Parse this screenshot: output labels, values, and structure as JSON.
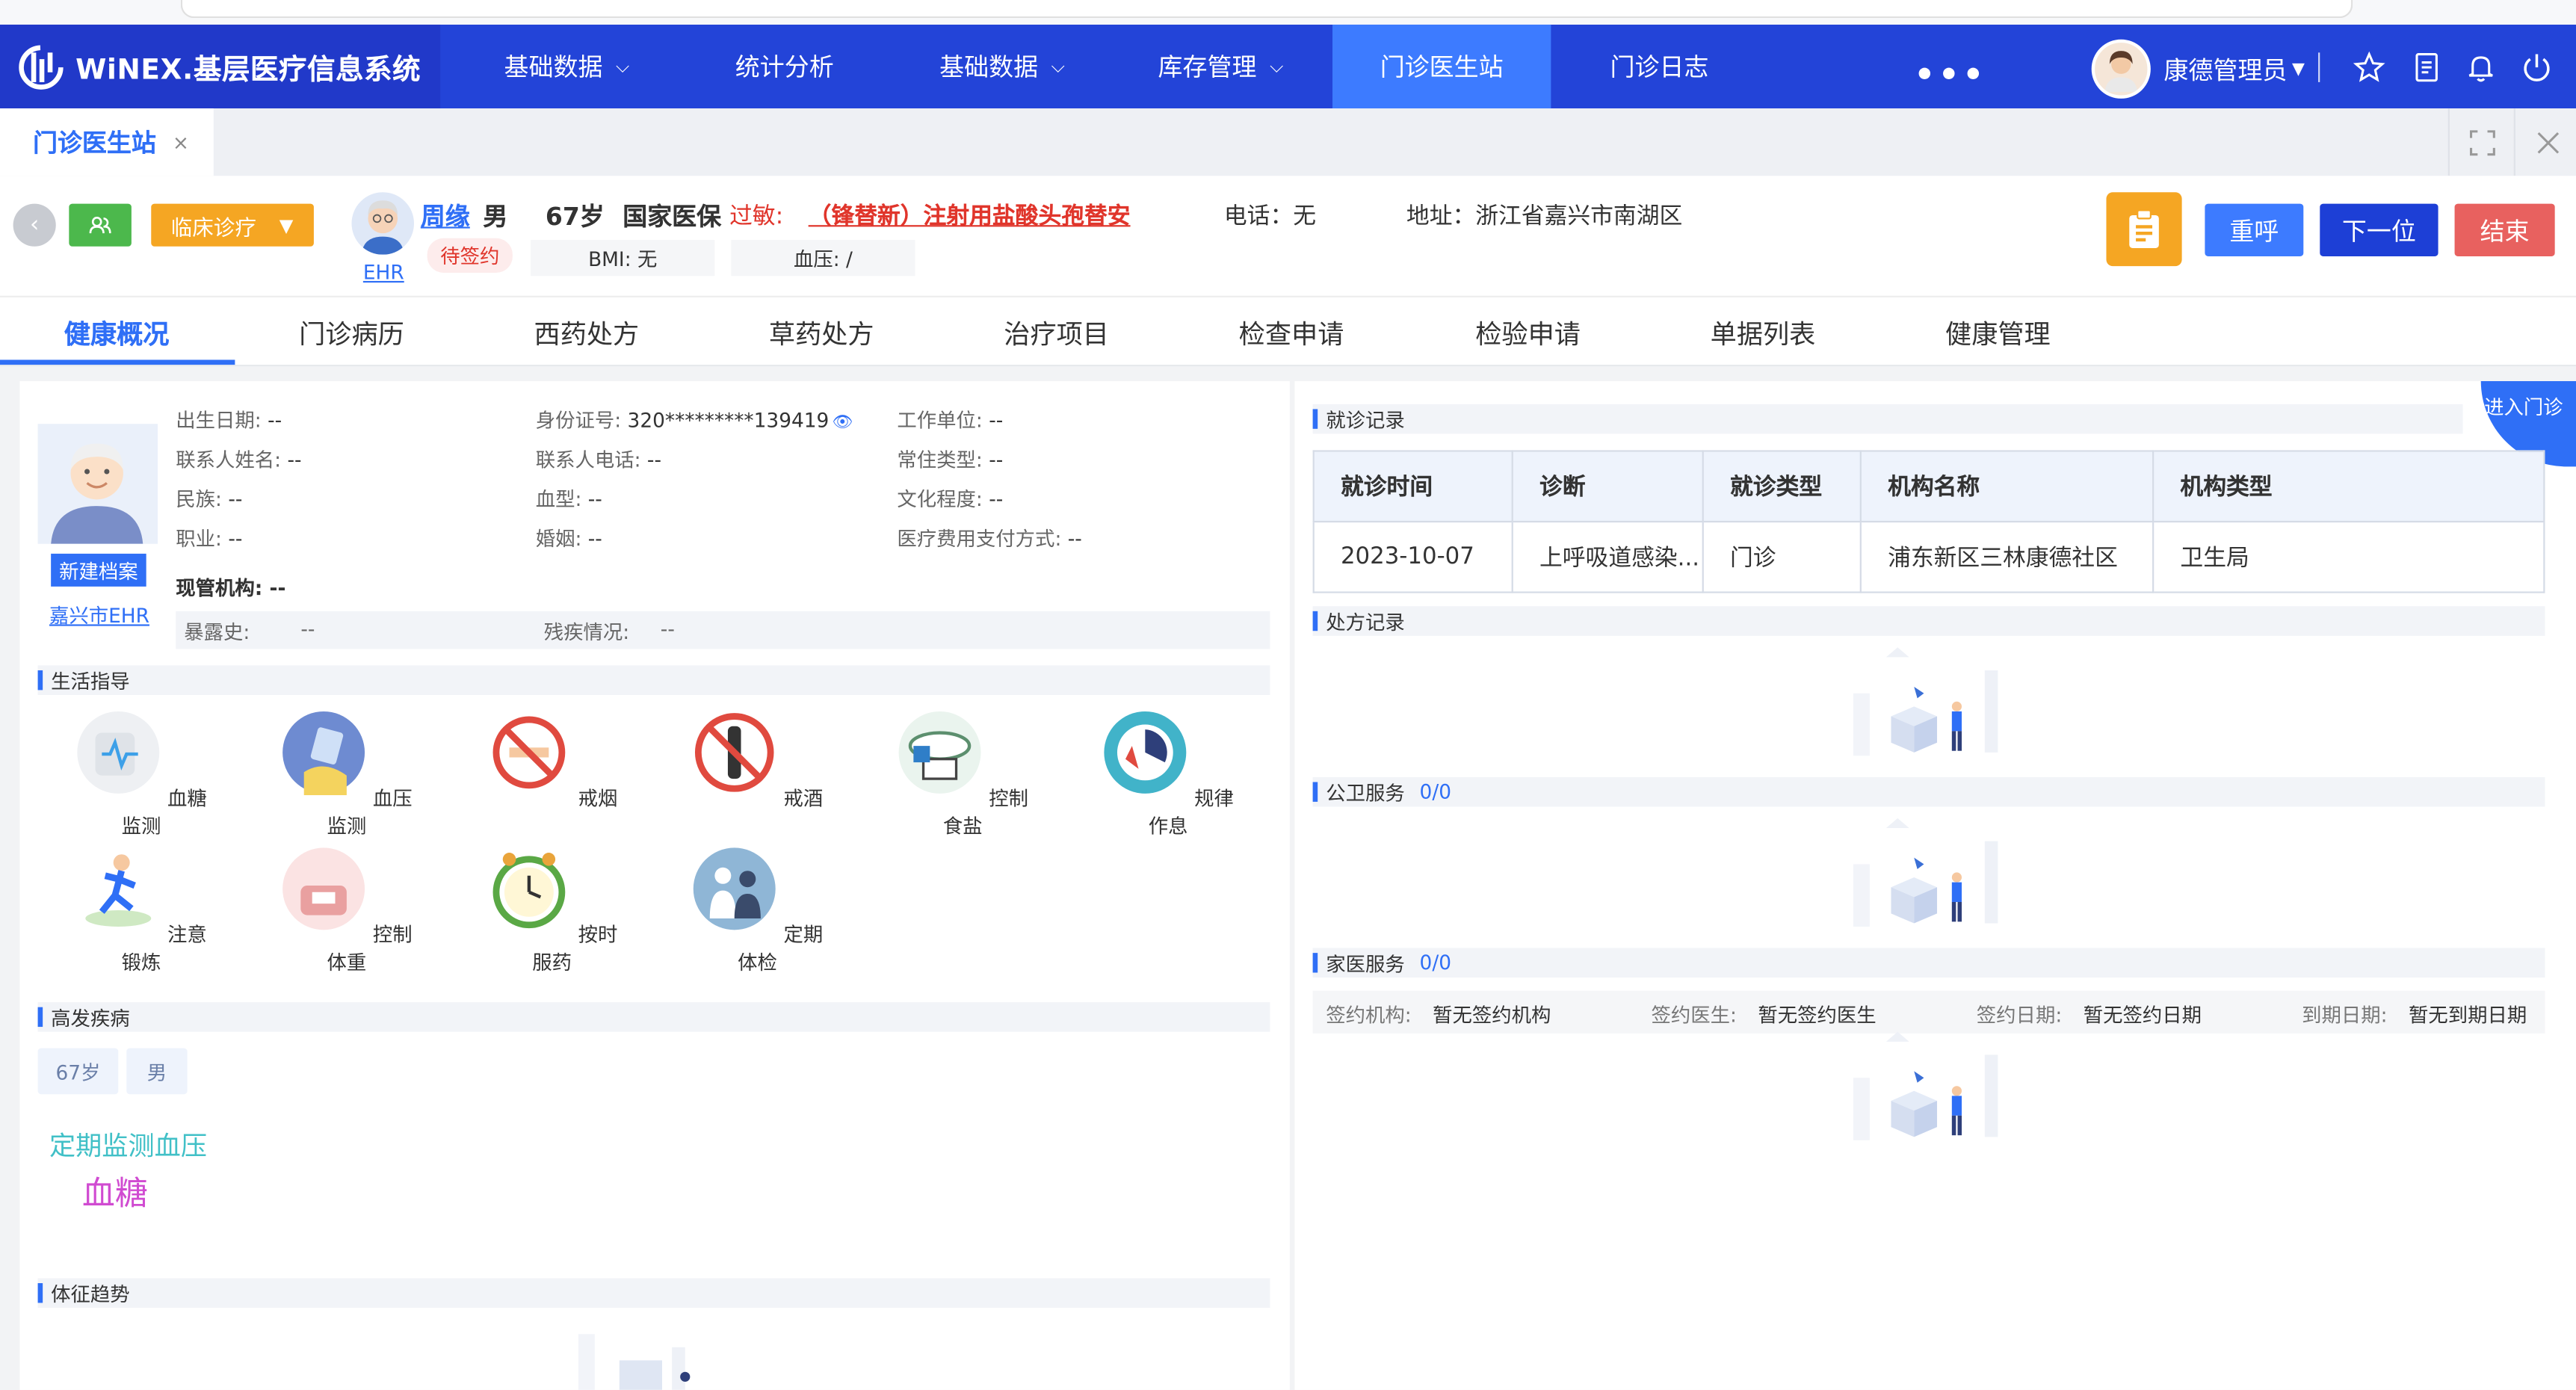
{
  "app": {
    "logo_text": "WiNEX.基层医疗信息系统"
  },
  "nav": {
    "items": [
      {
        "label": "基础数据",
        "chevron": true
      },
      {
        "label": "统计分析",
        "chevron": false
      },
      {
        "label": "基础数据",
        "chevron": true
      },
      {
        "label": "库存管理",
        "chevron": true
      },
      {
        "label": "门诊医生站",
        "chevron": false,
        "active": true
      },
      {
        "label": "门诊日志",
        "chevron": false
      }
    ],
    "more": "•••",
    "user": "康德管理员"
  },
  "tabs": {
    "page_tab": "门诊医生站",
    "close": "×"
  },
  "patient": {
    "clinic_btn": "临床诊疗",
    "ehr": "EHR",
    "name": "周缘",
    "sex": "男",
    "age": "67岁",
    "insurance": "国家医保",
    "allergy_label": "过敏:",
    "allergy": "（锋替新）注射用盐酸头孢替安",
    "sign_status": "待签约",
    "bmi": "BMI: 无",
    "bp": "血压: /",
    "phone": "电话：无",
    "address": "地址：浙江省嘉兴市南湖区",
    "btn_recall": "重呼",
    "btn_next": "下一位",
    "btn_end": "结束"
  },
  "subtabs": [
    "健康概况",
    "门诊病历",
    "西药处方",
    "草药处方",
    "治疗项目",
    "检查申请",
    "检验申请",
    "单据列表",
    "健康管理"
  ],
  "profile": {
    "new_record": "新建档案",
    "ehr_link": "嘉兴市EHR",
    "fields": [
      {
        "k": "出生日期:",
        "v": "--"
      },
      {
        "k": "身份证号:",
        "v": "320*********139419"
      },
      {
        "k": "工作单位:",
        "v": "--"
      },
      {
        "k": "联系人姓名:",
        "v": "--"
      },
      {
        "k": "联系人电话:",
        "v": "--"
      },
      {
        "k": "常住类型:",
        "v": "--"
      },
      {
        "k": "民族:",
        "v": "--"
      },
      {
        "k": "血型:",
        "v": "--"
      },
      {
        "k": "文化程度:",
        "v": "--"
      },
      {
        "k": "职业:",
        "v": "--"
      },
      {
        "k": "婚姻:",
        "v": "--"
      },
      {
        "k": "医疗费用支付方式:",
        "v": "--"
      }
    ],
    "org_label": "现管机构:",
    "org_value": "--",
    "exposure_label": "暴露史:",
    "exposure_value": "--",
    "disability_label": "残疾情况:",
    "disability_value": "--"
  },
  "life": {
    "title": "生活指导",
    "items": [
      "血糖监测",
      "血压监测",
      "戒烟",
      "戒酒",
      "控制食盐",
      "规律作息",
      "注意锻炼",
      "控制体重",
      "按时服药",
      "定期体检"
    ]
  },
  "disease": {
    "title": "高发疾病",
    "tags": [
      "67岁",
      "男"
    ],
    "word1": "定期监测血压",
    "word2": "血糖"
  },
  "vitals": {
    "title": "体征趋势"
  },
  "visits": {
    "title": "就诊记录",
    "enter": "进入门诊",
    "headers": [
      "就诊时间",
      "诊断",
      "就诊类型",
      "机构名称",
      "机构类型"
    ],
    "rows": [
      [
        "2023-10-07",
        "上呼吸道感染...",
        "门诊",
        "浦东新区三林康德社区",
        "卫生局"
      ]
    ]
  },
  "prescriptions": {
    "title": "处方记录"
  },
  "public_health": {
    "title": "公卫服务",
    "count": "0/0"
  },
  "family_doctor": {
    "title": "家医服务",
    "count": "0/0",
    "sign_org_k": "签约机构:",
    "sign_org_v": "暂无签约机构",
    "sign_doc_k": "签约医生:",
    "sign_doc_v": "暂无签约医生",
    "sign_date_k": "签约日期:",
    "sign_date_v": "暂无签约日期",
    "due_date_k": "到期日期:",
    "due_date_v": "暂无到期日期"
  },
  "colors": {
    "nav": "#2344d8",
    "nav_active": "#3d7bff",
    "accent": "#2f6ff6",
    "danger": "#e0352b",
    "orange": "#f5a623",
    "red_btn": "#e8615f",
    "navy_btn": "#1d3fd6"
  }
}
